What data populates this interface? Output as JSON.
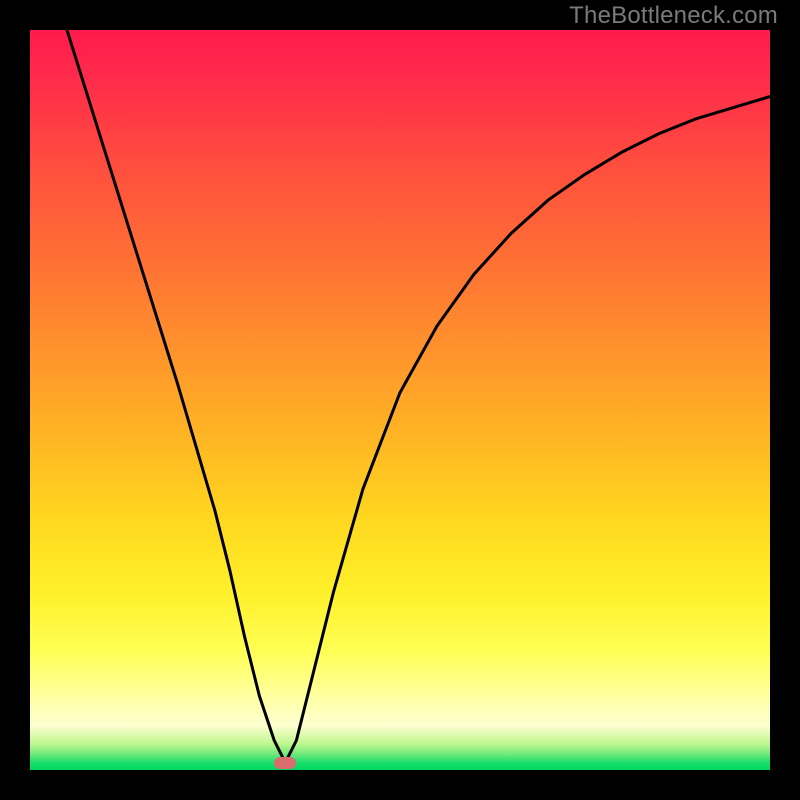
{
  "watermark": "TheBottleneck.com",
  "colors": {
    "frame_bg": "#000000",
    "watermark": "#7a7a7a",
    "curve": "#000000",
    "marker": "#d96c6c",
    "gradient_top": "#ff1a4d",
    "gradient_bottom": "#00d860"
  },
  "chart_data": {
    "type": "line",
    "title": "",
    "xlabel": "",
    "ylabel": "",
    "xlim": [
      0,
      100
    ],
    "ylim": [
      0,
      100
    ],
    "grid": false,
    "legend": false,
    "background": "vertical-gradient red→orange→yellow→green",
    "series": [
      {
        "name": "bottleneck-curve",
        "x": [
          5,
          10,
          15,
          20,
          25,
          27,
          29,
          31,
          33,
          34.5,
          36,
          38,
          41,
          45,
          50,
          55,
          60,
          65,
          70,
          75,
          80,
          85,
          90,
          95,
          100
        ],
        "y": [
          100,
          84,
          68,
          52,
          35,
          27,
          18,
          10,
          4,
          1,
          4,
          12,
          24,
          38,
          51,
          60,
          67,
          72.5,
          77,
          80.5,
          83.5,
          86,
          88,
          89.5,
          91
        ]
      }
    ],
    "annotations": [
      {
        "name": "min-marker",
        "x": 34.5,
        "y": 1,
        "shape": "rounded-pill",
        "color": "#d96c6c"
      }
    ]
  }
}
